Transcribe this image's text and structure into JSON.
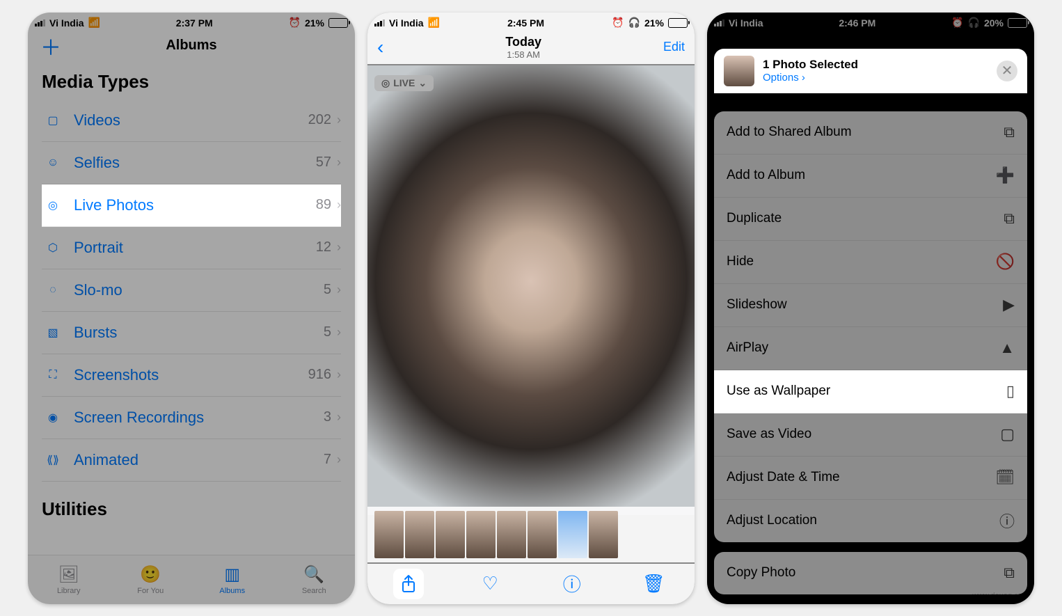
{
  "status": {
    "carrier": "Vi India"
  },
  "screen1": {
    "time": "2:37 PM",
    "battery": "21%",
    "title": "Albums",
    "section_media": "Media Types",
    "section_util": "Utilities",
    "rows": [
      {
        "label": "Videos",
        "count": "202"
      },
      {
        "label": "Selfies",
        "count": "57"
      },
      {
        "label": "Live Photos",
        "count": "89"
      },
      {
        "label": "Portrait",
        "count": "12"
      },
      {
        "label": "Slo-mo",
        "count": "5"
      },
      {
        "label": "Bursts",
        "count": "5"
      },
      {
        "label": "Screenshots",
        "count": "916"
      },
      {
        "label": "Screen Recordings",
        "count": "3"
      },
      {
        "label": "Animated",
        "count": "7"
      }
    ],
    "tabs": {
      "library": "Library",
      "foryou": "For You",
      "albums": "Albums",
      "search": "Search"
    }
  },
  "screen2": {
    "time": "2:45 PM",
    "battery": "21%",
    "title": "Today",
    "subtitle": "1:58 AM",
    "edit": "Edit",
    "live": "LIVE"
  },
  "screen3": {
    "time": "2:46 PM",
    "battery": "20%",
    "header_title": "1 Photo Selected",
    "header_options": "Options",
    "actions": [
      "Add to Shared Album",
      "Add to Album",
      "Duplicate",
      "Hide",
      "Slideshow",
      "AirPlay",
      "Use as Wallpaper",
      "Save as Video",
      "Adjust Date & Time",
      "Adjust Location",
      "Copy Photo"
    ]
  },
  "watermark": "www.deuaq.com"
}
